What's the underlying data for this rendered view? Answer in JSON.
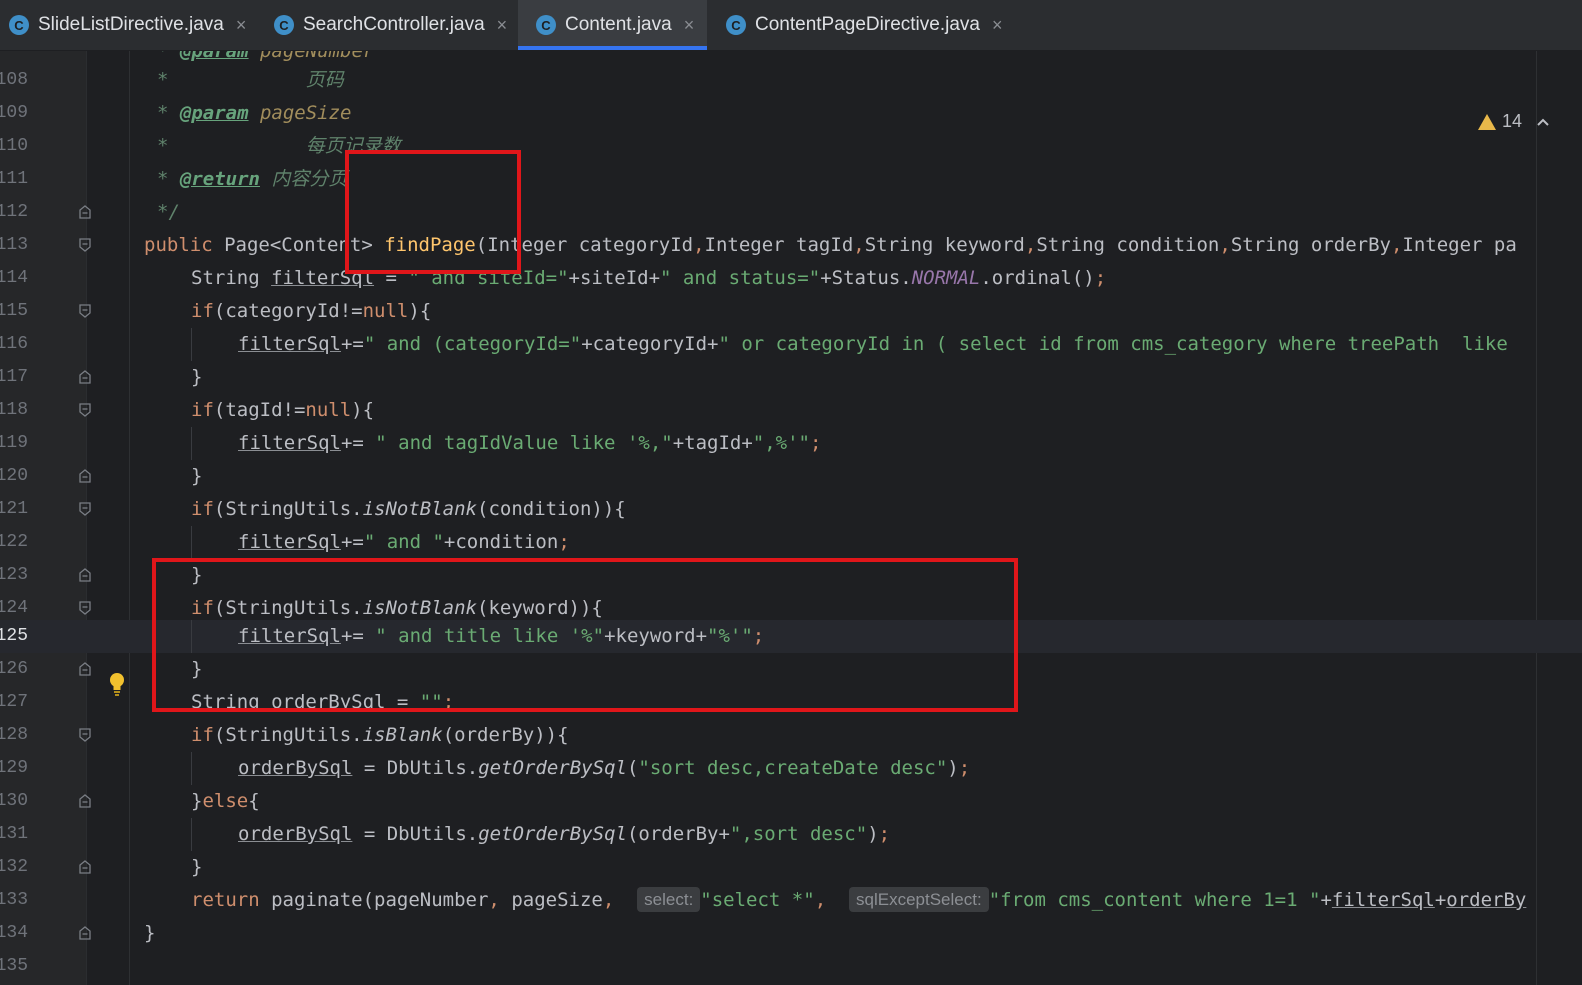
{
  "tabs": [
    {
      "icon": "C",
      "label": "SlideListDirective.java",
      "active": false
    },
    {
      "icon": "C",
      "label": "SearchController.java",
      "active": false
    },
    {
      "icon": "C",
      "label": "Content.java",
      "active": true
    },
    {
      "icon": "C",
      "label": "ContentPageDirective.java",
      "active": false
    }
  ],
  "close_glyph": "×",
  "warnings": {
    "count": "14",
    "icon": "warning-triangle-icon"
  },
  "line_numbers": [
    "108",
    "109",
    "110",
    "111",
    "112",
    "113",
    "114",
    "115",
    "116",
    "117",
    "118",
    "119",
    "120",
    "121",
    "122",
    "123",
    "124",
    "125",
    "126",
    "127",
    "128",
    "129",
    "130",
    "131",
    "132",
    "133",
    "134",
    "135"
  ],
  "current_line": "125",
  "code": {
    "l107_a": "* ",
    "l107_tag": "@param",
    "l107_b": " pageNumber",
    "l108_a": "*            ",
    "l108_b": "页码",
    "l109_a": "* ",
    "l109_tag": "@param",
    "l109_b": " pageSize",
    "l110_a": "*            ",
    "l110_b": "每页记录数",
    "l111_a": "* ",
    "l111_tag": "@return",
    "l111_b": " 内容分页",
    "l112": "*/",
    "l113_kw": "public ",
    "l113_a": "Page<Content> ",
    "l113_fn": "findPage",
    "l113_b": "(Integer categoryId",
    "l113_c": ",",
    "l113_d": "Integer tagId",
    "l113_e": ",",
    "l113_f": "String keyword",
    "l113_g": ",",
    "l113_h": "String condition",
    "l113_i": ",",
    "l113_j": "String orderBy",
    "l113_k": ",",
    "l113_l": "Integer pa",
    "l114_a": "String ",
    "l114_var": "filterSql",
    "l114_b": " = ",
    "l114_s1": "\" and siteId=\"",
    "l114_c": "+siteId+",
    "l114_s2": "\" and status=\"",
    "l114_d": "+Status.",
    "l114_const": "NORMAL",
    "l114_e": ".ordinal()",
    "l114_semi": ";",
    "l115_kw": "if",
    "l115_a": "(categoryId!=",
    "l115_null": "null",
    "l115_b": "){",
    "l116_var": "filterSql",
    "l116_a": "+=",
    "l116_s1": "\" and (categoryId=\"",
    "l116_b": "+categoryId+",
    "l116_s2": "\" or categoryId in ( select id from cms_category where treePath  like",
    "l117": "}",
    "l118_kw": "if",
    "l118_a": "(tagId!=",
    "l118_null": "null",
    "l118_b": "){",
    "l119_var": "filterSql",
    "l119_a": "+= ",
    "l119_s1": "\" and tagIdValue like '%,\"",
    "l119_b": "+tagId+",
    "l119_s2": "\",%'\"",
    "l119_semi": ";",
    "l120": "}",
    "l121_kw": "if",
    "l121_a": "(StringUtils.",
    "l121_m": "isNotBlank",
    "l121_b": "(condition)){",
    "l122_var": "filterSql",
    "l122_a": "+=",
    "l122_s1": "\" and \"",
    "l122_b": "+condition",
    "l122_semi": ";",
    "l123": "}",
    "l124_kw": "if",
    "l124_a": "(StringUtils.",
    "l124_m": "isNotBlank",
    "l124_b": "(keyword)){",
    "l125_var": "filterSql",
    "l125_a": "+= ",
    "l125_s1": "\" and title like '%\"",
    "l125_b": "+keyword+",
    "l125_s2": "\"%'\"",
    "l125_semi": ";",
    "l126": "}",
    "l127_a": "String ",
    "l127_var": "orderBySql",
    "l127_b": " = ",
    "l127_s1": "\"\"",
    "l127_semi": ";",
    "l128_kw": "if",
    "l128_a": "(StringUtils.",
    "l128_m": "isBlank",
    "l128_b": "(orderBy)){",
    "l129_var": "orderBySql",
    "l129_a": " = DbUtils.",
    "l129_m": "getOrderBySql",
    "l129_b": "(",
    "l129_s1": "\"sort desc,createDate desc\"",
    "l129_c": ")",
    "l129_semi": ";",
    "l130_a": "}",
    "l130_kw": "else",
    "l130_b": "{",
    "l131_var": "orderBySql",
    "l131_a": " = DbUtils.",
    "l131_m": "getOrderBySql",
    "l131_b": "(orderBy+",
    "l131_s1": "\",sort desc\"",
    "l131_c": ")",
    "l131_semi": ";",
    "l132": "}",
    "l133_kw": "return ",
    "l133_a": "paginate(pageNumber",
    "l133_c1": ", ",
    "l133_b": "pageSize",
    "l133_c2": ",  ",
    "l133_hint1": "select:",
    "l133_s1": "\"select *\"",
    "l133_c3": ",  ",
    "l133_hint2": "sqlExceptSelect:",
    "l133_s2": "\"from cms_content where 1=1 \"",
    "l133_d": "+",
    "l133_var1": "filterSql",
    "l133_e": "+",
    "l133_var2": "orderBy",
    "l134": "}"
  },
  "colors": {
    "accent": "#3574f0",
    "annotation_red": "#e0161a",
    "warning": "#e8b84a"
  }
}
